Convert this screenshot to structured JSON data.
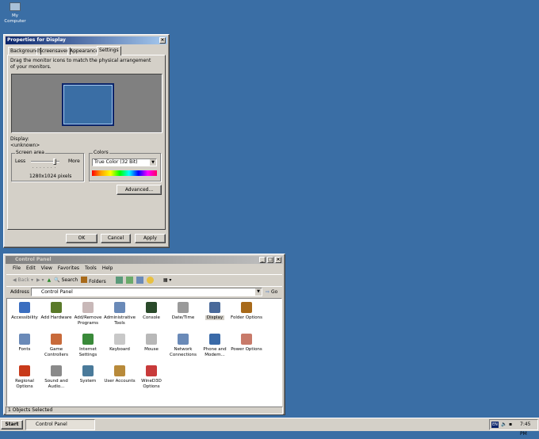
{
  "desktop": {
    "icons": [
      {
        "label": "My Computer",
        "icon": "computer-icon"
      }
    ]
  },
  "display_dialog": {
    "title": "Properties for Display",
    "tabs": [
      "Background",
      "Screensaver",
      "Appearance",
      "Settings"
    ],
    "active_tab": "Settings",
    "instruction": "Drag the monitor icons to match the physical arrangement of your monitors.",
    "display_label": "Display:",
    "display_value": "<unknown>",
    "screen_area": {
      "label": "Screen area",
      "less": "Less",
      "more": "More",
      "value": "1280x1024 pixels",
      "slider_position": 0.85
    },
    "colors": {
      "label": "Colors",
      "selected": "True Color (32 Bit)"
    },
    "advanced": "Advanced...",
    "ok": "OK",
    "cancel": "Cancel",
    "apply": "Apply"
  },
  "control_panel": {
    "title": "Control Panel",
    "menu": [
      "File",
      "Edit",
      "View",
      "Favorites",
      "Tools",
      "Help"
    ],
    "toolbar": {
      "back": "Back",
      "search": "Search",
      "folders": "Folders"
    },
    "address_label": "Address",
    "address_value": "Control Panel",
    "go": "Go",
    "items": [
      {
        "label": "Accessibility",
        "color": "#3a6ec0"
      },
      {
        "label": "Add Hardware",
        "color": "#5a7a2a"
      },
      {
        "label": "Add/Remove Programs",
        "color": "#c8b8b8"
      },
      {
        "label": "Administrative Tools",
        "color": "#6a8ab8"
      },
      {
        "label": "Console",
        "color": "#2a4a2a"
      },
      {
        "label": "Date/Time",
        "color": "#9a9a9a"
      },
      {
        "label": "Display",
        "color": "#4a6a9a"
      },
      {
        "label": "Folder Options",
        "color": "#a86a1a"
      },
      {
        "label": "Fonts",
        "color": "#6a8ab8"
      },
      {
        "label": "Game Controllers",
        "color": "#c86a3a"
      },
      {
        "label": "Internet Settings",
        "color": "#3a8a3a"
      },
      {
        "label": "Keyboard",
        "color": "#c8c8c8"
      },
      {
        "label": "Mouse",
        "color": "#b8b8b8"
      },
      {
        "label": "Network Connections",
        "color": "#6a8ab8"
      },
      {
        "label": "Phone and Modem...",
        "color": "#3a6aa8"
      },
      {
        "label": "Power Options",
        "color": "#c87a6a"
      },
      {
        "label": "Regional Options",
        "color": "#c83a1a"
      },
      {
        "label": "Sound and Audio...",
        "color": "#8a8a8a"
      },
      {
        "label": "System",
        "color": "#4a7a9a"
      },
      {
        "label": "User Accounts",
        "color": "#b88a3a"
      },
      {
        "label": "WineD3D Options",
        "color": "#c83a3a"
      }
    ],
    "selected_item": "Display",
    "status": "1 Objects Selected"
  },
  "taskbar": {
    "start": "Start",
    "tasks": [
      "Control Panel"
    ],
    "tray_lang": "EN",
    "clock": "7:45 PM"
  }
}
